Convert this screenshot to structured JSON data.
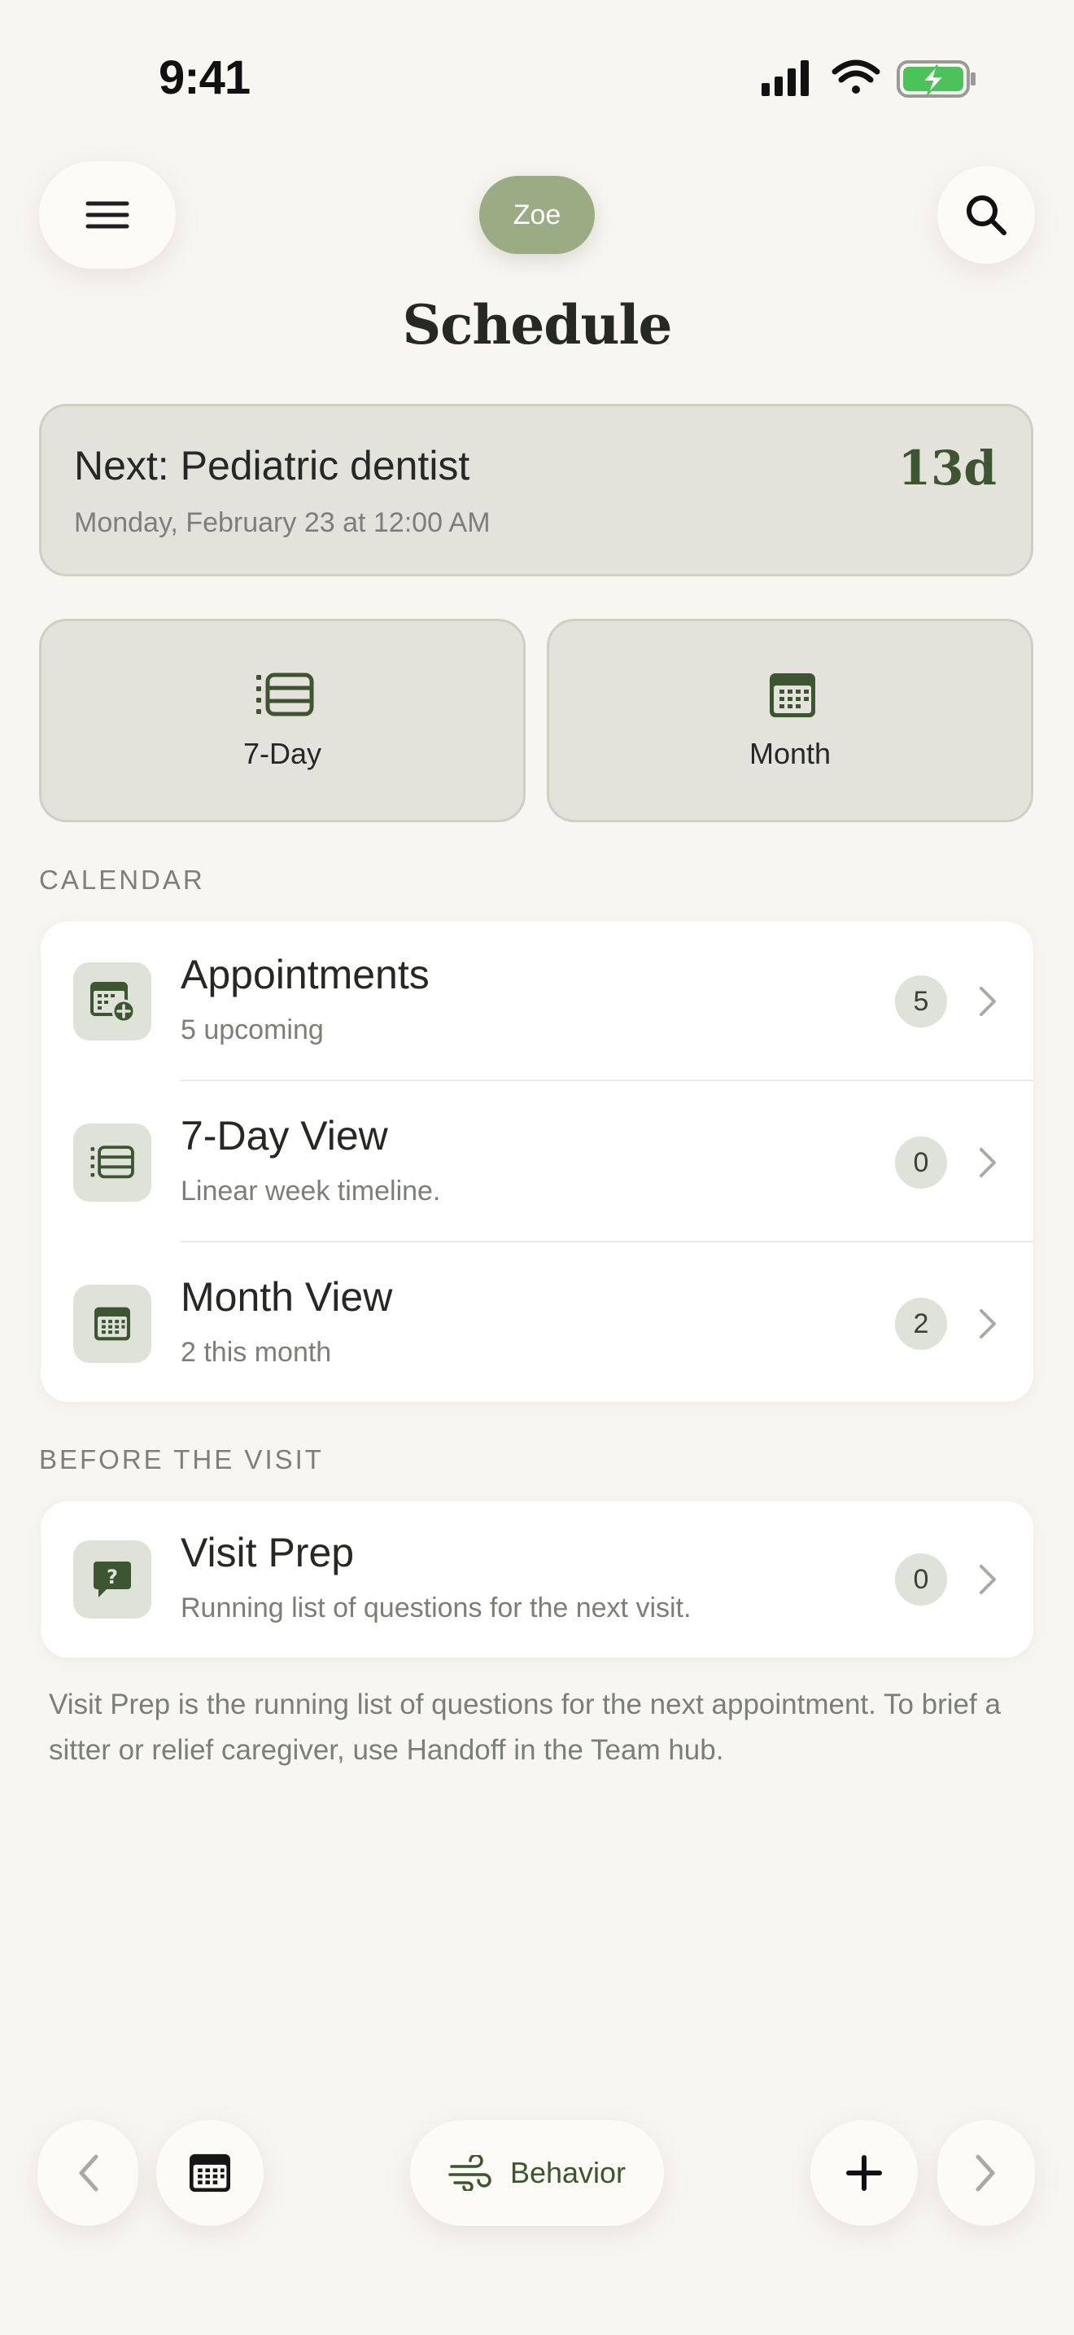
{
  "status_bar": {
    "time": "9:41"
  },
  "header": {
    "profile": "Zoe",
    "title": "Schedule"
  },
  "next_appointment": {
    "title": "Next: Pediatric dentist",
    "datetime": "Monday, February 23 at 12:00 AM",
    "countdown": "13d"
  },
  "views": [
    {
      "label": "7-Day",
      "icon": "timeline-icon"
    },
    {
      "label": "Month",
      "icon": "calendar-icon"
    }
  ],
  "sections": {
    "calendar": {
      "label": "CALENDAR",
      "rows": [
        {
          "title": "Appointments",
          "subtitle": "5 upcoming",
          "badge": "5",
          "icon": "calendar-add-icon"
        },
        {
          "title": "7-Day View",
          "subtitle": "Linear week timeline.",
          "badge": "0",
          "icon": "timeline-icon"
        },
        {
          "title": "Month View",
          "subtitle": "2 this month",
          "badge": "2",
          "icon": "calendar-icon"
        }
      ]
    },
    "before_visit": {
      "label": "BEFORE THE VISIT",
      "rows": [
        {
          "title": "Visit Prep",
          "subtitle": "Running list of questions for the next visit.",
          "badge": "0",
          "icon": "question-bubble-icon"
        }
      ]
    }
  },
  "footnote": "Visit Prep is the running list of questions for the next appointment. To brief a sitter or relief caregiver, use Handoff in the Team hub.",
  "bottom_bar": {
    "behavior_label": "Behavior"
  },
  "colors": {
    "accent": "#3d5530",
    "chip": "#9bab84",
    "background": "#f8f6f1",
    "card": "#e4e3db"
  }
}
